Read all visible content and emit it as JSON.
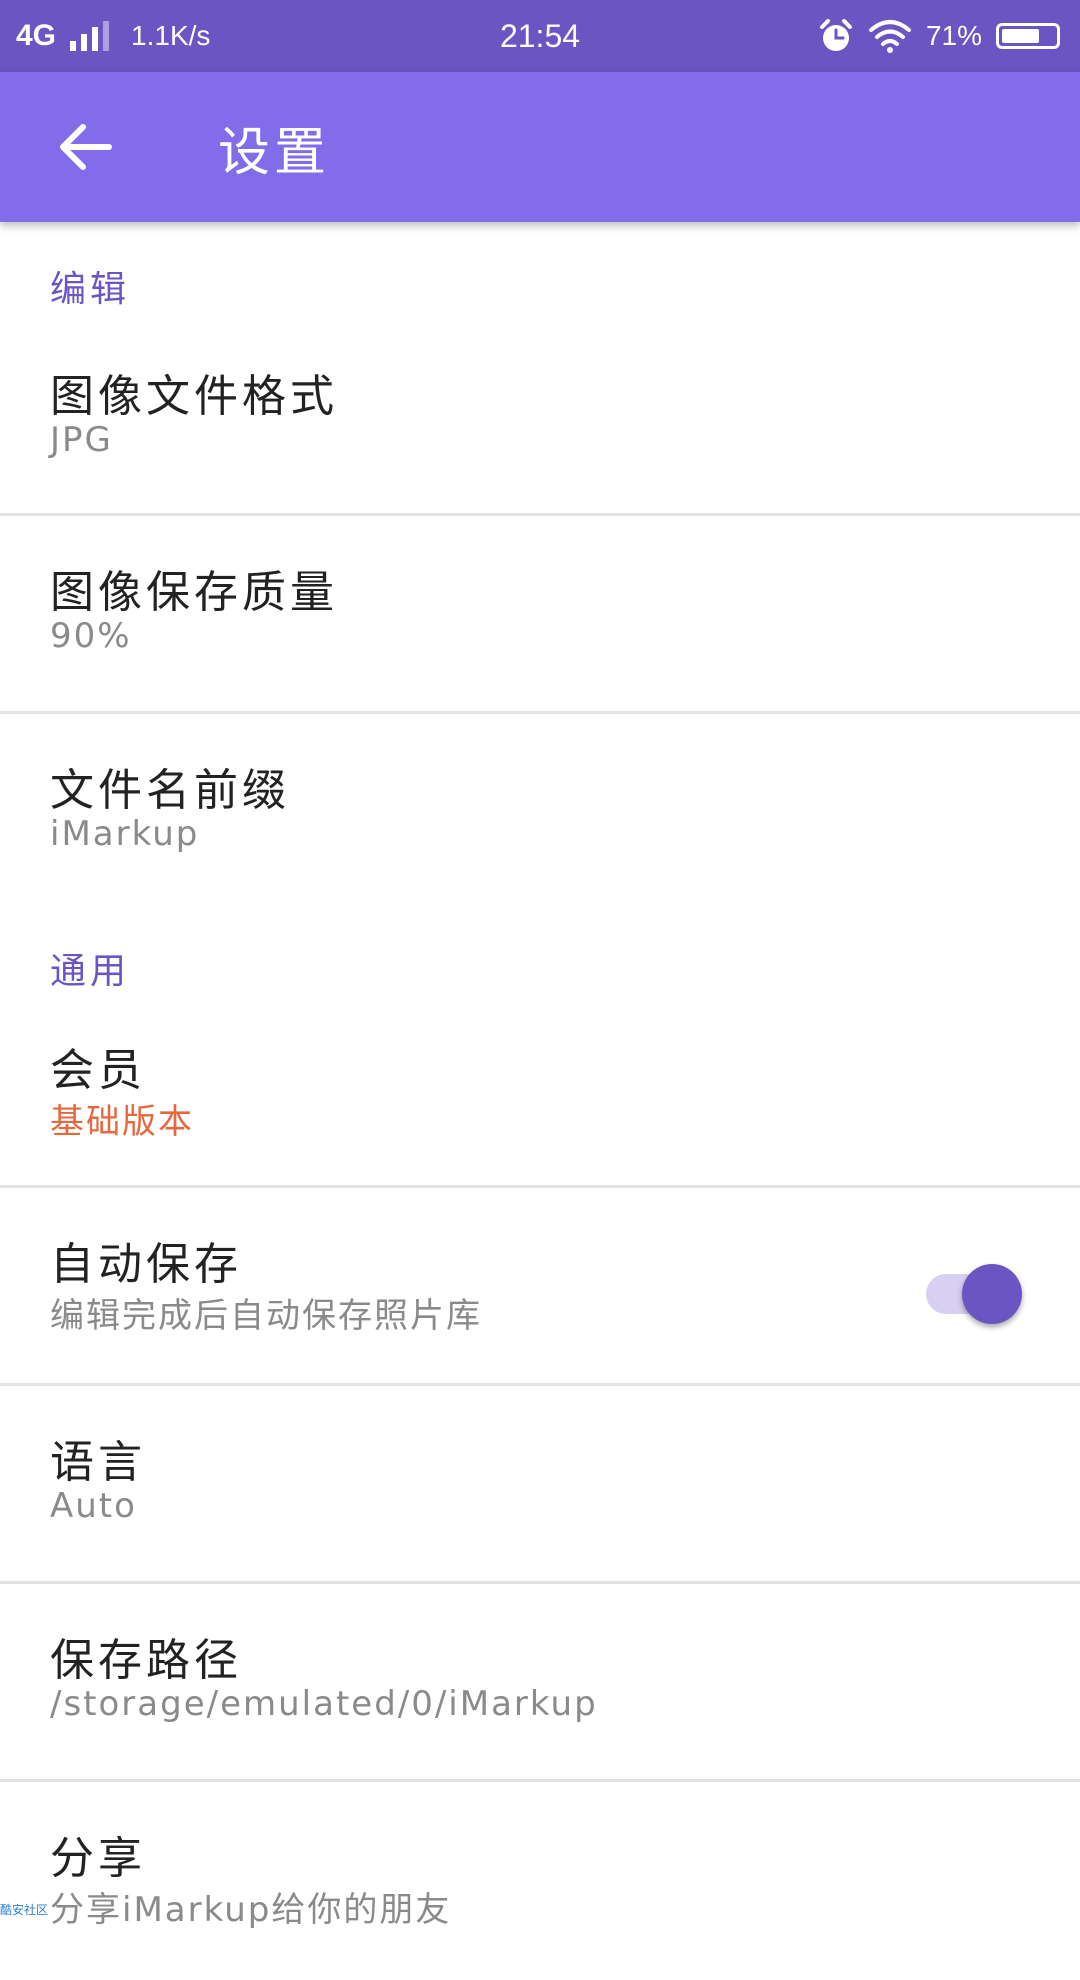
{
  "status_bar": {
    "network": "4G",
    "speed": "1.1K/s",
    "time": "21:54",
    "battery": "71%",
    "battery_level": 0.71,
    "icons": [
      "signal-icon",
      "alarm-icon",
      "wifi-icon",
      "battery-icon"
    ]
  },
  "app_bar": {
    "title": "设置",
    "back_icon": "arrow-left-icon"
  },
  "sections": {
    "edit": {
      "header": "编辑",
      "image_format": {
        "title": "图像文件格式",
        "summary": "JPG"
      },
      "image_quality": {
        "title": "图像保存质量",
        "summary": "90%"
      },
      "file_prefix": {
        "title": "文件名前缀",
        "summary": "iMarkup"
      }
    },
    "general": {
      "header": "通用",
      "membership": {
        "title": "会员",
        "summary": "基础版本"
      },
      "auto_save": {
        "title": "自动保存",
        "summary": "编辑完成后自动保存照片库",
        "enabled": true
      },
      "language": {
        "title": "语言",
        "summary": "Auto"
      },
      "save_path": {
        "title": "保存路径",
        "summary": "/storage/emulated/0/iMarkup"
      },
      "share": {
        "title": "分享",
        "summary": "分享iMarkup给你的朋友"
      }
    }
  },
  "colors": {
    "status_bar": "#6a55c2",
    "app_bar": "#836ce9",
    "accent": "#6a55c2",
    "membership_summary": "#e4693f"
  },
  "watermark": "酷安社区"
}
